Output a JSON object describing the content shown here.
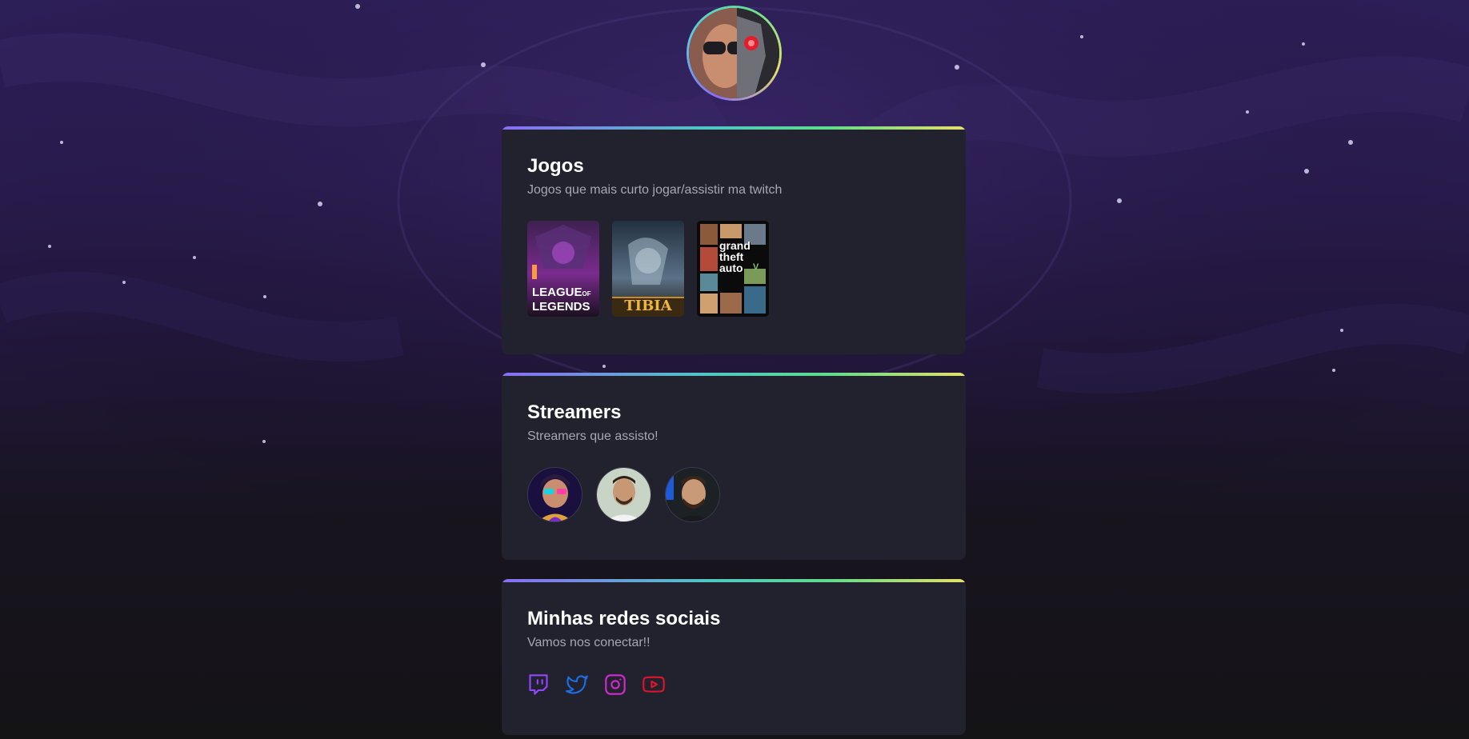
{
  "profile": {
    "avatar_icon": "profile-avatar"
  },
  "games_card": {
    "title": "Jogos",
    "subtitle": "Jogos que mais curto jogar/assistir ma twitch",
    "games": [
      {
        "name": "league-of-legends",
        "line1": "LEAGUE",
        "line1b": "OF",
        "line2": "LEGENDS"
      },
      {
        "name": "tibia",
        "label": "TIBIA"
      },
      {
        "name": "gta-v",
        "line1": "grand",
        "line2": "theft",
        "line3": "auto",
        "badge": "V"
      }
    ]
  },
  "streamers_card": {
    "title": "Streamers",
    "subtitle": "Streamers que assisto!",
    "streamers": [
      {
        "avatar": "streamer-avatar-1"
      },
      {
        "avatar": "streamer-avatar-2"
      },
      {
        "avatar": "streamer-avatar-3"
      }
    ]
  },
  "social_card": {
    "title": "Minhas redes sociais",
    "subtitle": "Vamos nos conectar!!",
    "links": [
      {
        "icon": "twitch-icon",
        "color": "#9146ff"
      },
      {
        "icon": "twitter-icon",
        "color": "#1d6fe8"
      },
      {
        "icon": "instagram-icon",
        "color": "#d62ad1"
      },
      {
        "icon": "youtube-icon",
        "color": "#e0142a"
      }
    ]
  }
}
